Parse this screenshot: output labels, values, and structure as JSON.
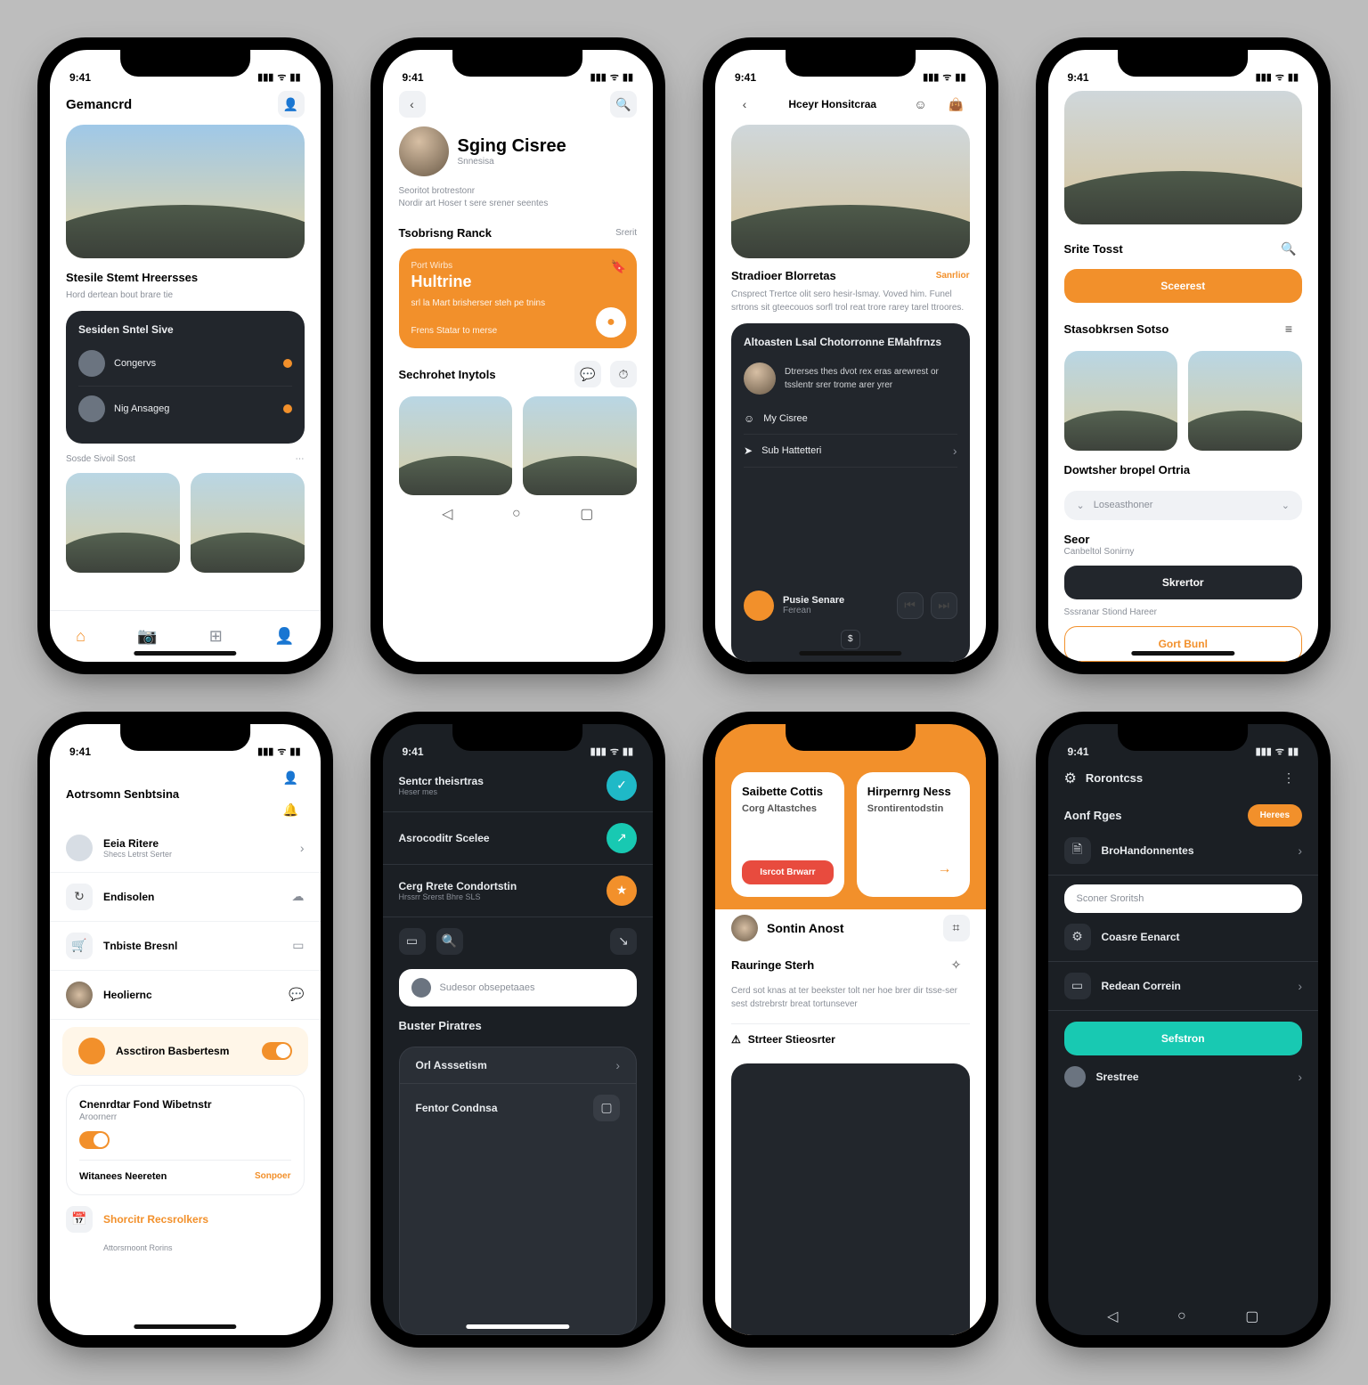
{
  "status": {
    "time": "9:41",
    "signal": "▮▮▮",
    "wifi": "ᯤ",
    "batt": "▮▮"
  },
  "colors": {
    "accent": "#f2902b",
    "dark": "#22262c",
    "teal": "#18c9b2",
    "red": "#e84b3e"
  },
  "s1": {
    "brand": "Gemancrd",
    "hero_cap1": "Stesile Stemt Hreersses",
    "hero_cap2": "Hord dertean bout brare tie",
    "card_title": "Sesiden Sntel Sive",
    "row1": "Congervs",
    "row2": "Nig Ansageg",
    "foot_label": "Sosde Sivoil Sost",
    "tabs": [
      "⌂",
      "📷",
      "⊞",
      "👤"
    ]
  },
  "s2": {
    "name": "Sging Cisree",
    "role": "Snnesisa",
    "bio1": "Seoritot brotrestonr",
    "bio2": "Nordir art Hoser t sere srener seentes",
    "s_header": "Tsobrisng Ranck",
    "s_link": "Srerit",
    "oc_sub": "Port Wirbs",
    "oc_title": "Hultrine",
    "oc_line": "srl la Mart brisherser steh pe tnins",
    "oc_btn": "Frens Statar to merse",
    "sect2": "Sechrohet Inytols"
  },
  "s3": {
    "title": "Hceyr Honsitcraa",
    "sect": "Stradioer Blorretas",
    "link": "Sanrlior",
    "body": "Cnsprect Trertce olit sero hesir-lsmay. Voved him. Funel srtrons sit gteecouos sorfl trol reat trore rarey tarel ttroores.",
    "dc_title": "Altoasten Lsal Chotorronne EMahfrnzs",
    "dc_body": "Dtrerses thes dvot rex eras arewrest or tsslentr srer trome arer yrer",
    "dc_user": "My Cisree",
    "dc_row": "Sub Hattetteri",
    "fab_label": "Pusie Senare",
    "fab_sub": "Ferean"
  },
  "s4": {
    "s1": "Srite Tosst",
    "cta": "Sceerest",
    "s2": "Stasobkrsen Sotso",
    "s3": "Dowtsher bropel Ortria",
    "field": "Loseasthoner",
    "s4": "Seor",
    "s5": "Canbeltol Sonirny",
    "btn_dark": "Skrertor",
    "foot_note": "Sssranar Stiond Hareer",
    "btn_outline": "Gort Bunl"
  },
  "s5": {
    "title": "Aotrsomn Senbtsina",
    "rows": [
      {
        "t": "Eeia Ritere",
        "s": "Shecs Letrst Serter"
      },
      {
        "t": "Endisolen",
        "s": ""
      },
      {
        "t": "Tnbiste Bresnl",
        "s": ""
      },
      {
        "t": "Heoliernc",
        "s": ""
      }
    ],
    "hl_row": {
      "t": "Assctiron Basbertesm",
      "tog": true
    },
    "card_title": "Cnenrdtar Fond Wibetnstr",
    "card_sub": "Aroornerr",
    "foot1": "Witanees Neereten",
    "foot1_link": "Sonpoer",
    "foot2": "Shorcitr Recsrolkers",
    "foot3": "Attorsrnoont Rorins"
  },
  "s6": {
    "rows": [
      {
        "t": "Sentcr theisrtras",
        "s": "Heser mes",
        "c": "#1fb9c7"
      },
      {
        "t": "Asrocoditr Scelee",
        "s": "",
        "c": "#18c9b2"
      },
      {
        "t": "Cerg Rrete Condortstin",
        "s": "Hrssrr Srerst Bhre SLS",
        "c": "#f2902b"
      }
    ],
    "search": "Sudesor obsepetaaes",
    "p_title": "Buster Piratres",
    "row1": "Orl Asssetism",
    "row2": "Fentor Condnsa"
  },
  "s7": {
    "card1": {
      "t": "Saibette Cottis",
      "s": "Corg Altastches",
      "foot": "Isrcot Brwarr"
    },
    "card2": {
      "t": "Hirpernrg Ness",
      "s": "Srontirentodstin",
      "foot": "→"
    },
    "user": "Sontin Anost",
    "sect": "Rauringe Sterh",
    "body": "Cerd sot knas at ter beekster tolt ner hoe brer dir tsse-ser sest dstrebrstr breat tortunsever",
    "bad": "Strteer Stieosrter"
  },
  "s8": {
    "brand": "Rorontcss",
    "s1": "Aonf Rges",
    "chip": "Herees",
    "row1": "BroHandonnentes",
    "field1": "Sconer Sroritsh",
    "drow1": "Coasre Eenarct",
    "drow2": "Redean Correin",
    "cta": "Sefstron",
    "foot_row": "Srestree"
  }
}
